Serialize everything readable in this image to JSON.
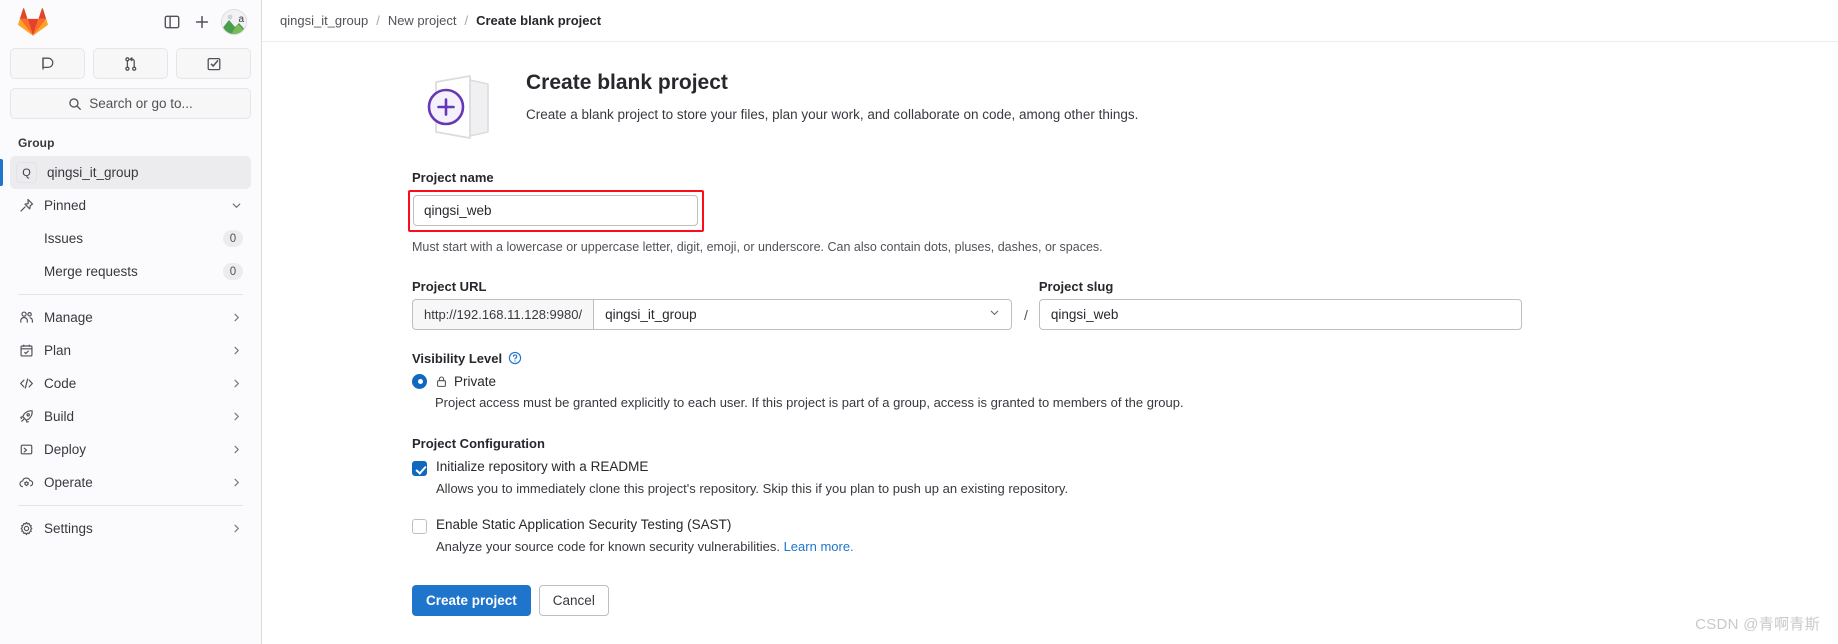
{
  "sidebar": {
    "top_icons": [
      {
        "name": "toggle-sidebar-icon",
        "title": "Primary navigation"
      },
      {
        "name": "new-item-icon",
        "title": "Create new..."
      }
    ],
    "avatar_title": "User menu",
    "quicklinks": [
      {
        "name": "issues-icon",
        "title": "Issues"
      },
      {
        "name": "merge-requests-icon",
        "title": "Merge requests"
      },
      {
        "name": "todos-icon",
        "title": "To-Do List"
      }
    ],
    "search_placeholder": "Search or go to...",
    "section_label": "Group",
    "group": {
      "initial": "Q",
      "label": "qingsi_it_group"
    },
    "items": [
      {
        "label": "Pinned",
        "icon": "pin-icon",
        "chevron": "down",
        "sub": false
      },
      {
        "label": "Issues",
        "icon": "",
        "badge": "0",
        "sub": true
      },
      {
        "label": "Merge requests",
        "icon": "",
        "badge": "0",
        "sub": true
      },
      {
        "label": "Manage",
        "icon": "users-icon",
        "chevron": "right",
        "sub": false
      },
      {
        "label": "Plan",
        "icon": "calendar-icon",
        "chevron": "right",
        "sub": false
      },
      {
        "label": "Code",
        "icon": "code-icon",
        "chevron": "right",
        "sub": false
      },
      {
        "label": "Build",
        "icon": "rocket-icon",
        "chevron": "right",
        "sub": false
      },
      {
        "label": "Deploy",
        "icon": "deploy-icon",
        "chevron": "right",
        "sub": false
      },
      {
        "label": "Operate",
        "icon": "cloud-gear-icon",
        "chevron": "right",
        "sub": false
      },
      {
        "label": "Settings",
        "icon": "gear-icon",
        "chevron": "right",
        "sub": false
      }
    ]
  },
  "breadcrumb": {
    "items": [
      "qingsi_it_group",
      "New project",
      "Create blank project"
    ],
    "separator": "/"
  },
  "hero": {
    "title": "Create blank project",
    "subtitle": "Create a blank project to store your files, plan your work, and collaborate on code, among other things."
  },
  "form": {
    "project_name": {
      "label": "Project name",
      "value": "qingsi_web",
      "hint": "Must start with a lowercase or uppercase letter, digit, emoji, or underscore. Can also contain dots, pluses, dashes, or spaces."
    },
    "project_url": {
      "label": "Project URL",
      "prefix": "http://192.168.11.128:9980/",
      "namespace": "qingsi_it_group"
    },
    "separator": "/",
    "project_slug": {
      "label": "Project slug",
      "value": "qingsi_web"
    },
    "visibility": {
      "label": "Visibility Level",
      "help_icon": "question-circle-icon",
      "option_label": "Private",
      "option_icon": "lock-icon",
      "description": "Project access must be granted explicitly to each user. If this project is part of a group, access is granted to members of the group."
    },
    "configuration": {
      "label": "Project Configuration",
      "options": [
        {
          "label": "Initialize repository with a README",
          "checked": true,
          "description": "Allows you to immediately clone this project's repository. Skip this if you plan to push up an existing repository."
        },
        {
          "label": "Enable Static Application Security Testing (SAST)",
          "checked": false,
          "description": "Analyze your source code for known security vulnerabilities.",
          "link_text": "Learn more.",
          "link_color": "#1f75cb"
        }
      ]
    },
    "actions": {
      "submit": "Create project",
      "cancel": "Cancel"
    }
  },
  "watermark": "CSDN @青啊青斯",
  "colors": {
    "accent_blue": "#1f75cb",
    "brand_orange": "#fc6d26",
    "highlight_red": "#fc0d1b",
    "purple": "#6638b6"
  }
}
